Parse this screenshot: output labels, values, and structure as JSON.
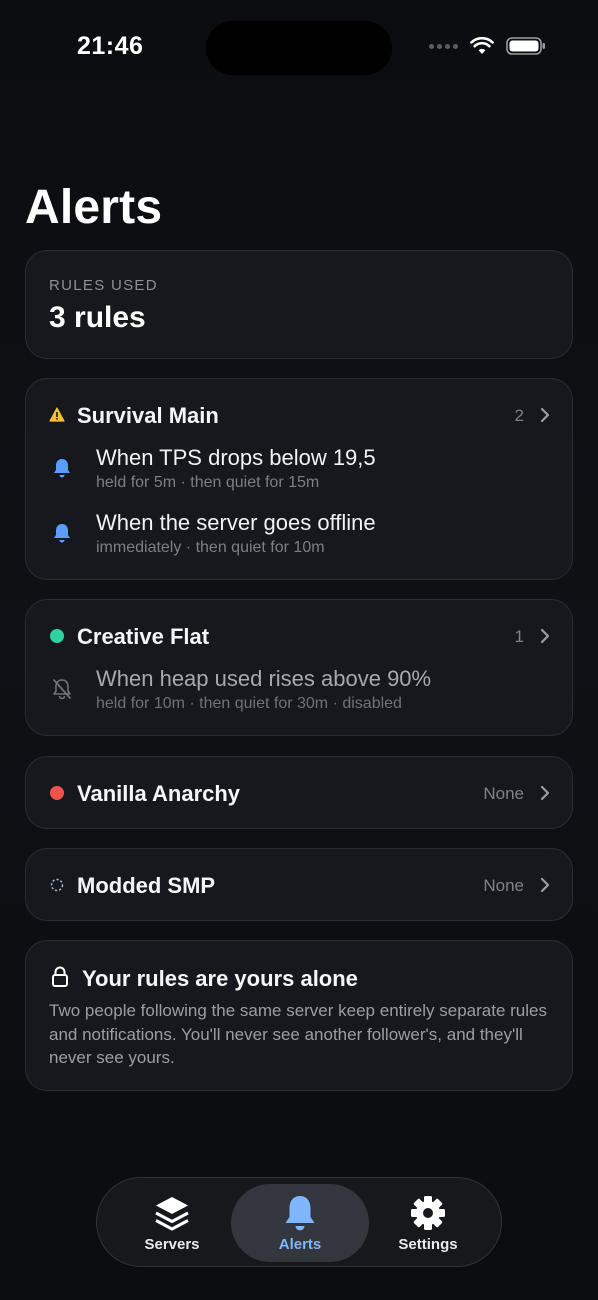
{
  "status": {
    "time": "21:46"
  },
  "page": {
    "title": "Alerts"
  },
  "summary": {
    "label": "RULES USED",
    "value": "3 rules"
  },
  "servers": [
    {
      "name": "Survival Main",
      "count": "2",
      "status_icon": "warning-triangle-icon",
      "status_color": "#f5c033",
      "rules": [
        {
          "title": "When TPS drops below 19,5",
          "detail": "held for 5m · then quiet for 15m",
          "icon": "bell-icon"
        },
        {
          "title": "When the server goes offline",
          "detail": "immediately · then quiet for 10m",
          "icon": "bell-icon"
        }
      ]
    },
    {
      "name": "Creative Flat",
      "count": "1",
      "status_icon": "online-dot-icon",
      "status_color": "#2fd3a0",
      "rules": [
        {
          "title": "When heap used rises above 90%",
          "detail": "held for 10m · then quiet for 30m · disabled",
          "icon": "bell-slash-icon"
        }
      ]
    },
    {
      "name": "Vanilla Anarchy",
      "count": "None",
      "status_icon": "offline-dot-icon",
      "status_color": "#f0534a",
      "rules": []
    },
    {
      "name": "Modded SMP",
      "count": "None",
      "status_icon": "unknown-dashed-dot-icon",
      "status_color": "#a9b4c9",
      "rules": []
    }
  ],
  "privacy_note": {
    "title": "Your rules are yours alone",
    "body": "Two people following the same server keep entirely separate rules and notifications. You'll never see another follower's, and they'll never see yours."
  },
  "tabs": [
    {
      "label": "Servers",
      "icon": "stack-icon"
    },
    {
      "label": "Alerts",
      "icon": "bell-icon",
      "active": true
    },
    {
      "label": "Settings",
      "icon": "gear-icon"
    }
  ],
  "colors": {
    "accent": "#7fb6ff",
    "bell": "#5a9cff",
    "card": "#16181d"
  }
}
